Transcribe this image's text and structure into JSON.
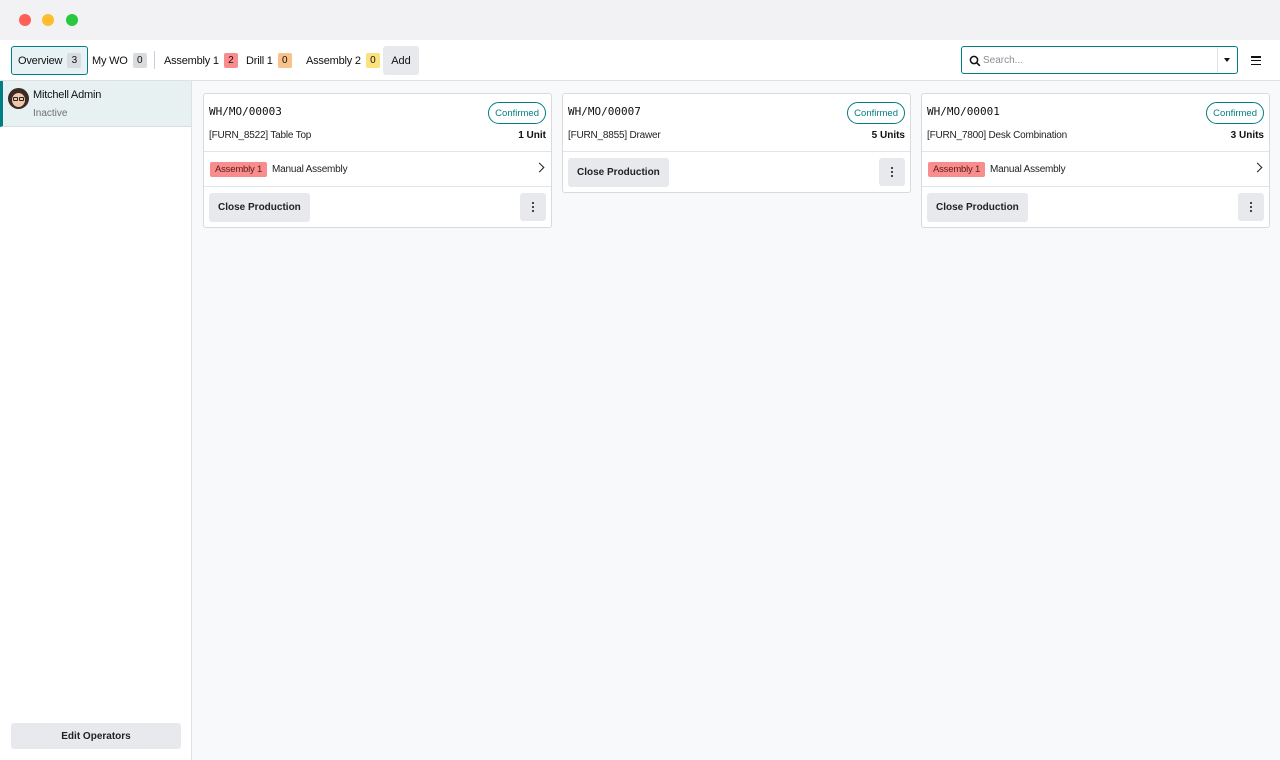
{
  "toolbar": {
    "tabs": [
      {
        "label": "Overview",
        "count": "3"
      },
      {
        "label": "My WO",
        "count": "0"
      },
      {
        "label": "Assembly 1",
        "count": "2"
      },
      {
        "label": "Drill 1",
        "count": "0"
      },
      {
        "label": "Assembly 2",
        "count": "0"
      }
    ],
    "add_label": "Add",
    "search": {
      "placeholder": "Search...",
      "value": ""
    },
    "icons": {
      "search": "search-icon",
      "dropdown": "caret-down-icon",
      "menu": "hamburger-menu-icon"
    }
  },
  "sidebar": {
    "operator": {
      "name": "Mitchell Admin",
      "status": "Inactive"
    },
    "edit_operators_label": "Edit Operators"
  },
  "cards": [
    {
      "reference": "WH/MO/00003",
      "state": "Confirmed",
      "product": "[FURN_8522] Table Top",
      "quantity": "1 Unit",
      "workorder": {
        "workcenter": "Assembly 1",
        "name": "Manual Assembly"
      },
      "close_label": "Close Production"
    },
    {
      "reference": "WH/MO/00007",
      "state": "Confirmed",
      "product": "[FURN_8855] Drawer",
      "quantity": "5 Units",
      "close_label": "Close Production"
    },
    {
      "reference": "WH/MO/00001",
      "state": "Confirmed",
      "product": "[FURN_7800] Desk Combination",
      "quantity": "3 Units",
      "workorder": {
        "workcenter": "Assembly 1",
        "name": "Manual Assembly"
      },
      "close_label": "Close Production"
    }
  ],
  "colors": {
    "accent": "#017e84",
    "badge_red": "#f98c8c",
    "badge_orange": "#f9c28a",
    "badge_yellow": "#fbe27c"
  }
}
